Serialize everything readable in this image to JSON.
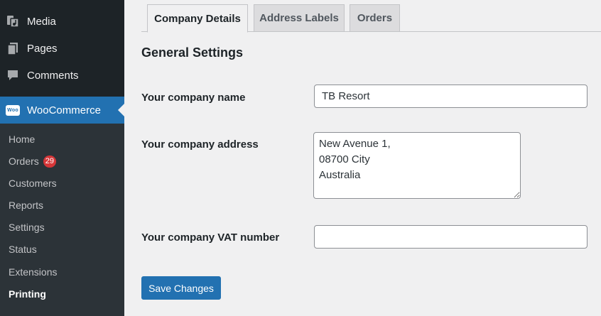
{
  "sidebar": {
    "menu": [
      {
        "label": "Media",
        "icon": "media-icon"
      },
      {
        "label": "Pages",
        "icon": "pages-icon"
      },
      {
        "label": "Comments",
        "icon": "comments-icon"
      },
      {
        "label": "WooCommerce",
        "icon": "woocommerce-icon",
        "icon_text": "Woo",
        "active": true
      }
    ],
    "submenu": [
      {
        "label": "Home"
      },
      {
        "label": "Orders",
        "badge": "29"
      },
      {
        "label": "Customers"
      },
      {
        "label": "Reports"
      },
      {
        "label": "Settings"
      },
      {
        "label": "Status"
      },
      {
        "label": "Extensions"
      },
      {
        "label": "Printing",
        "current": true
      }
    ]
  },
  "tabs": [
    {
      "label": "Company Details",
      "active": true
    },
    {
      "label": "Address Labels"
    },
    {
      "label": "Orders"
    }
  ],
  "form": {
    "section_title": "General Settings",
    "company_name": {
      "label": "Your company name",
      "value": "TB Resort"
    },
    "company_address": {
      "label": "Your company address",
      "value": "New Avenue 1,\n08700 City\nAustralia"
    },
    "company_vat": {
      "label": "Your company VAT number",
      "value": ""
    },
    "save_label": "Save Changes"
  },
  "colors": {
    "accent": "#2271b1",
    "sidebar_bg": "#1d2327",
    "submenu_bg": "#2c3338",
    "badge": "#d63638"
  }
}
